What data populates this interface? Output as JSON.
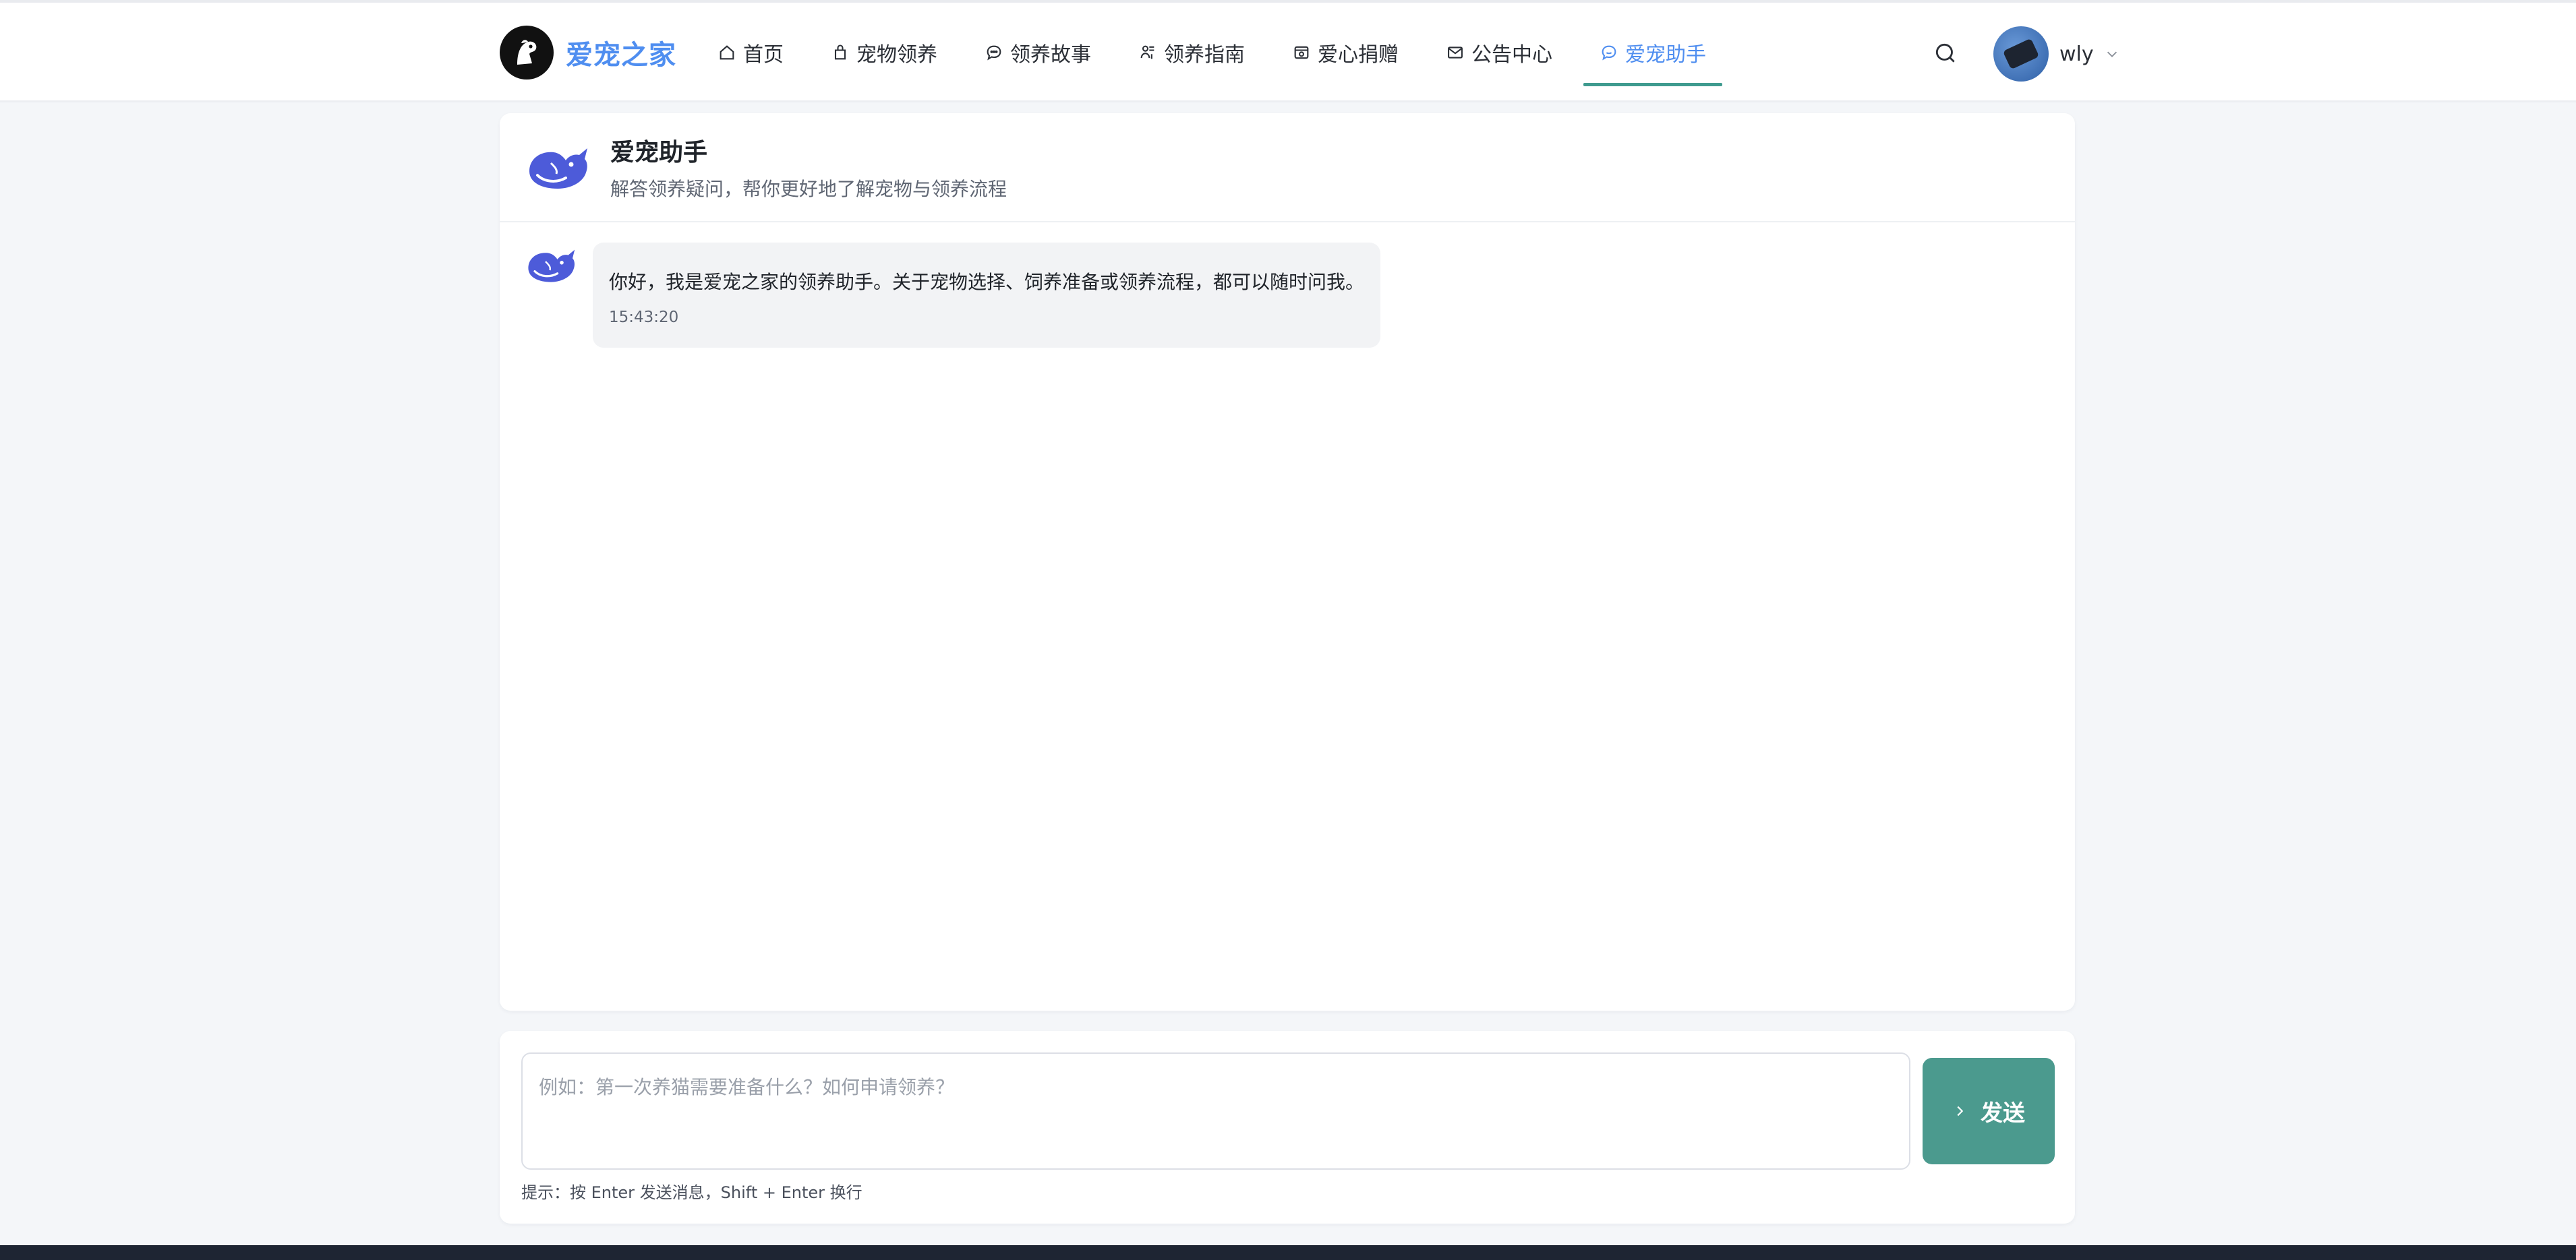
{
  "brand": {
    "name": "爱宠之家",
    "color": "#4f8ef0"
  },
  "nav": {
    "items": [
      {
        "label": "首页",
        "icon": "home-icon"
      },
      {
        "label": "宠物领养",
        "icon": "bag-icon"
      },
      {
        "label": "领养故事",
        "icon": "chat-bubble-icon"
      },
      {
        "label": "领养指南",
        "icon": "guide-icon"
      },
      {
        "label": "爱心捐赠",
        "icon": "donation-icon"
      },
      {
        "label": "公告中心",
        "icon": "mail-icon"
      },
      {
        "label": "爱宠助手",
        "icon": "assistant-chat-icon",
        "active": true
      }
    ],
    "active_color": "#4f8ef0",
    "active_underline_color": "#3f9b8f"
  },
  "user": {
    "name": "wly"
  },
  "assistant": {
    "title": "爱宠助手",
    "subtitle": "解答领养疑问，帮你更好地了解宠物与领养流程",
    "icon_color": "#4d5bd9"
  },
  "messages": [
    {
      "role": "assistant",
      "text": "你好，我是爱宠之家的领养助手。关于宠物选择、饲养准备或领养流程，都可以随时问我。",
      "time": "15:43:20"
    }
  ],
  "composer": {
    "placeholder": "例如：第一次养猫需要准备什么？如何申请领养？",
    "value": "",
    "send_label": "发送",
    "send_color": "#4b9a8e",
    "hint": "提示：按 Enter 发送消息，Shift + Enter 换行"
  }
}
